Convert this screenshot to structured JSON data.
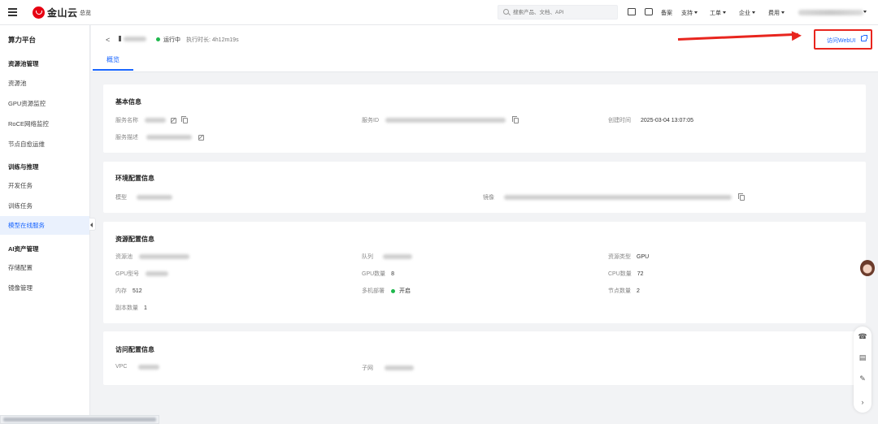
{
  "topbar": {
    "logo_text": "金山云",
    "overview": "总览",
    "search_placeholder": "搜索产品、文档、API",
    "nav": [
      "备案",
      "支持",
      "工单",
      "企业",
      "费用"
    ]
  },
  "sidebar": {
    "title": "算力平台",
    "groups": [
      {
        "label": "资源池管理",
        "items": [
          "资源池",
          "GPU资源监控",
          "RoCE网络监控",
          "节点自愈运维"
        ]
      },
      {
        "label": "训练与推理",
        "items": [
          "开发任务",
          "训练任务",
          "模型在线服务"
        ]
      },
      {
        "label": "AI资产管理",
        "items": [
          "存储配置",
          "镜像管理"
        ]
      }
    ],
    "active_item": "模型在线服务"
  },
  "header": {
    "back": "<",
    "status": "运行中",
    "runtime_label": "执行时长: 4h12m19s",
    "tab": "概览",
    "webui_label": "访问WebUI"
  },
  "basic": {
    "title": "基本信息",
    "service_name_label": "服务名称",
    "service_id_label": "服务ID",
    "created_label": "创建时间",
    "created_value": "2025-03-04 13:07:05",
    "desc_label": "服务描述"
  },
  "env": {
    "title": "环境配置信息",
    "model_label": "模型",
    "image_label": "镜像"
  },
  "resource": {
    "title": "资源配置信息",
    "pool_label": "资源池",
    "queue_label": "队列",
    "type_label": "资源类型",
    "type_value": "GPU",
    "gpu_model_label": "GPU型号",
    "gpu_count_label": "GPU数量",
    "gpu_count_value": "8",
    "cpu_count_label": "CPU数量",
    "cpu_count_value": "72",
    "memory_label": "内存",
    "memory_value": "512",
    "multi_label": "多机部署",
    "multi_value": "开启",
    "node_label": "节点数量",
    "node_value": "2",
    "replica_label": "副本数量",
    "replica_value": "1"
  },
  "access": {
    "title": "访问配置信息",
    "vpc_label": "VPC",
    "subnet_label": "子网"
  },
  "colors": {
    "accent": "#1a66ff",
    "status_green": "#1fb84d",
    "highlight_red": "#e8251e"
  }
}
